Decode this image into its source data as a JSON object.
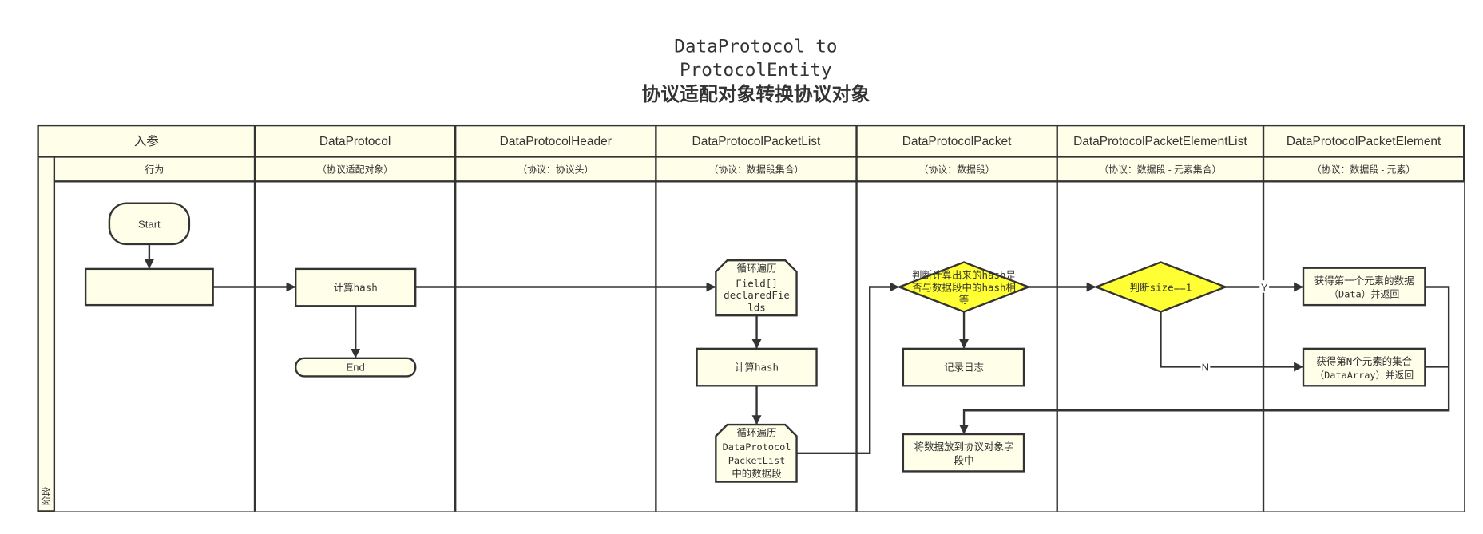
{
  "title": {
    "line1": "DataProtocol to",
    "line2": "ProtocolEntity",
    "line3": "协议适配对象转换协议对象"
  },
  "columns": [
    {
      "header": "入参",
      "sub": "行为"
    },
    {
      "header": "DataProtocol",
      "sub": "（协议适配对象）"
    },
    {
      "header": "DataProtocolHeader",
      "sub": "（协议：协议头）"
    },
    {
      "header": "DataProtocolPacketList",
      "sub": "（协议：数据段集合）"
    },
    {
      "header": "DataProtocolPacket",
      "sub": "（协议：数据段）"
    },
    {
      "header": "DataProtocolPacketElementList",
      "sub": "（协议：数据段 - 元素集合）"
    },
    {
      "header": "DataProtocolPacketElement",
      "sub": "（协议：数据段 - 元素）"
    }
  ],
  "lane_label": "阶段",
  "nodes": {
    "start": "Start",
    "input_box": "",
    "calc_hash_1": "计算hash",
    "end": "End",
    "loop_fields": [
      "循环遍历",
      "Field[]",
      "declaredFie",
      "lds"
    ],
    "calc_hash_2": "计算hash",
    "loop_packets": [
      "循环遍历",
      "DataProtocol",
      "PacketList",
      "中的数据段"
    ],
    "hash_check": [
      "判断计算出来的hash是",
      "否与数据段中的hash相",
      "等"
    ],
    "log": "记录日志",
    "put_data": [
      "将数据放到协议对象字",
      "段中"
    ],
    "size_check": "判断size==1",
    "get_first": [
      "获得第一个元素的数据",
      "（Data）并返回"
    ],
    "get_n": [
      "获得第N个元素的集合",
      "（DataArray）并返回"
    ]
  },
  "edge_labels": {
    "yes": "Y",
    "no": "N"
  },
  "colors": {
    "node_fill": "#fefee9",
    "decision_fill": "#ffff33",
    "stroke": "#333333"
  }
}
